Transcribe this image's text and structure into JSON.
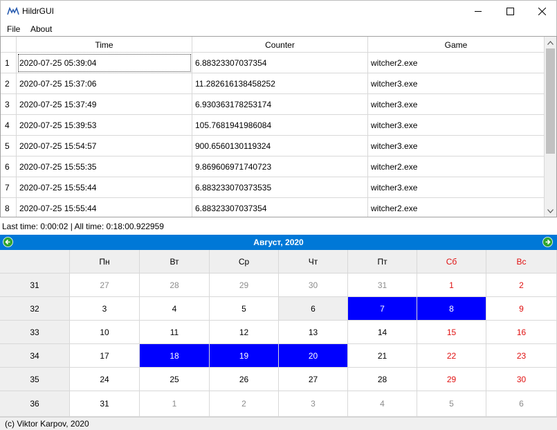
{
  "window": {
    "title": "HildrGUI"
  },
  "menu": {
    "file": "File",
    "about": "About"
  },
  "table": {
    "headers": [
      "Time",
      "Counter",
      "Game"
    ],
    "rows": [
      {
        "num": "1",
        "time": "2020-07-25 05:39:04",
        "counter": "6.88323307037354",
        "game": "witcher2.exe"
      },
      {
        "num": "2",
        "time": "2020-07-25 15:37:06",
        "counter": "11.282616138458252",
        "game": "witcher3.exe"
      },
      {
        "num": "3",
        "time": "2020-07-25 15:37:49",
        "counter": "6.930363178253174",
        "game": "witcher3.exe"
      },
      {
        "num": "4",
        "time": "2020-07-25 15:39:53",
        "counter": "105.7681941986084",
        "game": "witcher3.exe"
      },
      {
        "num": "5",
        "time": "2020-07-25 15:54:57",
        "counter": "900.6560130119324",
        "game": "witcher3.exe"
      },
      {
        "num": "6",
        "time": "2020-07-25 15:55:35",
        "counter": "9.869606971740723",
        "game": "witcher2.exe"
      },
      {
        "num": "7",
        "time": "2020-07-25 15:55:44",
        "counter": "6.883233070373535",
        "game": "witcher3.exe"
      },
      {
        "num": "8",
        "time": "2020-07-25 15:55:44",
        "counter": "6.88323307037354",
        "game": "witcher2.exe"
      }
    ]
  },
  "status": {
    "text": "Last time: 0:00:02  |  All time: 0:18:00.922959"
  },
  "calendar": {
    "month_label": "Август,  2020",
    "weekdays": [
      "Пн",
      "Вт",
      "Ср",
      "Чт",
      "Пт",
      "Сб",
      "Вс"
    ],
    "weeks": [
      {
        "num": "31",
        "days": [
          "27",
          "28",
          "29",
          "30",
          "31",
          "1",
          "2"
        ]
      },
      {
        "num": "32",
        "days": [
          "3",
          "4",
          "5",
          "6",
          "7",
          "8",
          "9"
        ]
      },
      {
        "num": "33",
        "days": [
          "10",
          "11",
          "12",
          "13",
          "14",
          "15",
          "16"
        ]
      },
      {
        "num": "34",
        "days": [
          "17",
          "18",
          "19",
          "20",
          "21",
          "22",
          "23"
        ]
      },
      {
        "num": "35",
        "days": [
          "24",
          "25",
          "26",
          "27",
          "28",
          "29",
          "30"
        ]
      },
      {
        "num": "36",
        "days": [
          "31",
          "1",
          "2",
          "3",
          "4",
          "5",
          "6"
        ]
      }
    ],
    "highlight_color": "#0000ff",
    "weekend_color": "#e01010",
    "nav_color": "#0078d7"
  },
  "footer": {
    "text": "(c) Viktor Karpov, 2020"
  }
}
